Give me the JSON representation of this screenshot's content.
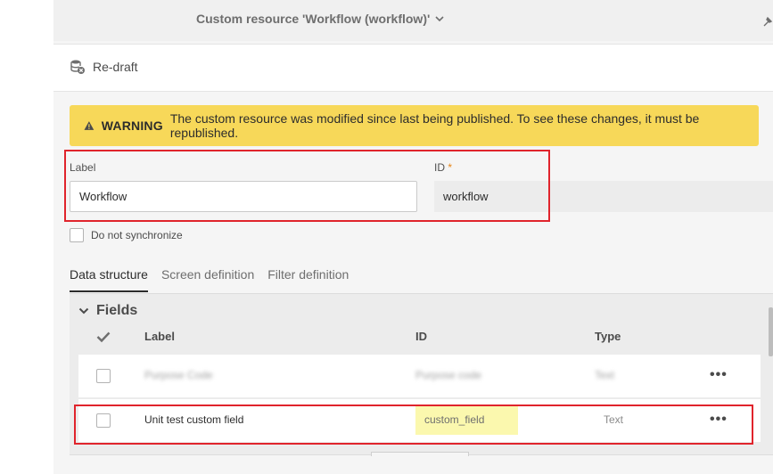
{
  "header": {
    "title": "Custom resource 'Workflow (workflow)'"
  },
  "toolbar": {
    "redraft_label": "Re-draft"
  },
  "warning": {
    "label": "WARNING",
    "message": "The custom resource was modified since last being published. To see these changes, it must be republished."
  },
  "form": {
    "label_caption": "Label",
    "label_value": "Workflow",
    "id_caption": "ID",
    "id_required_marker": "*",
    "id_value": "workflow",
    "sync_checkbox_label": "Do not synchronize"
  },
  "tabs": [
    {
      "label": "Data structure",
      "active": true
    },
    {
      "label": "Screen definition",
      "active": false
    },
    {
      "label": "Filter definition",
      "active": false
    }
  ],
  "fields": {
    "section_title": "Fields",
    "columns": {
      "label": "Label",
      "id": "ID",
      "type": "Type"
    },
    "rows": [
      {
        "label": "Purpose Code",
        "id": "Purpose code",
        "type": "Text",
        "blurred": true
      },
      {
        "label": "Unit test custom field",
        "id": "custom_field",
        "type": "Text",
        "blurred": false
      }
    ],
    "row_menu_glyph": "•••"
  },
  "colors": {
    "warning_bg": "#f7d859",
    "highlight_annotation": "#e0242c",
    "id_highlight": "#fbf8ae"
  }
}
